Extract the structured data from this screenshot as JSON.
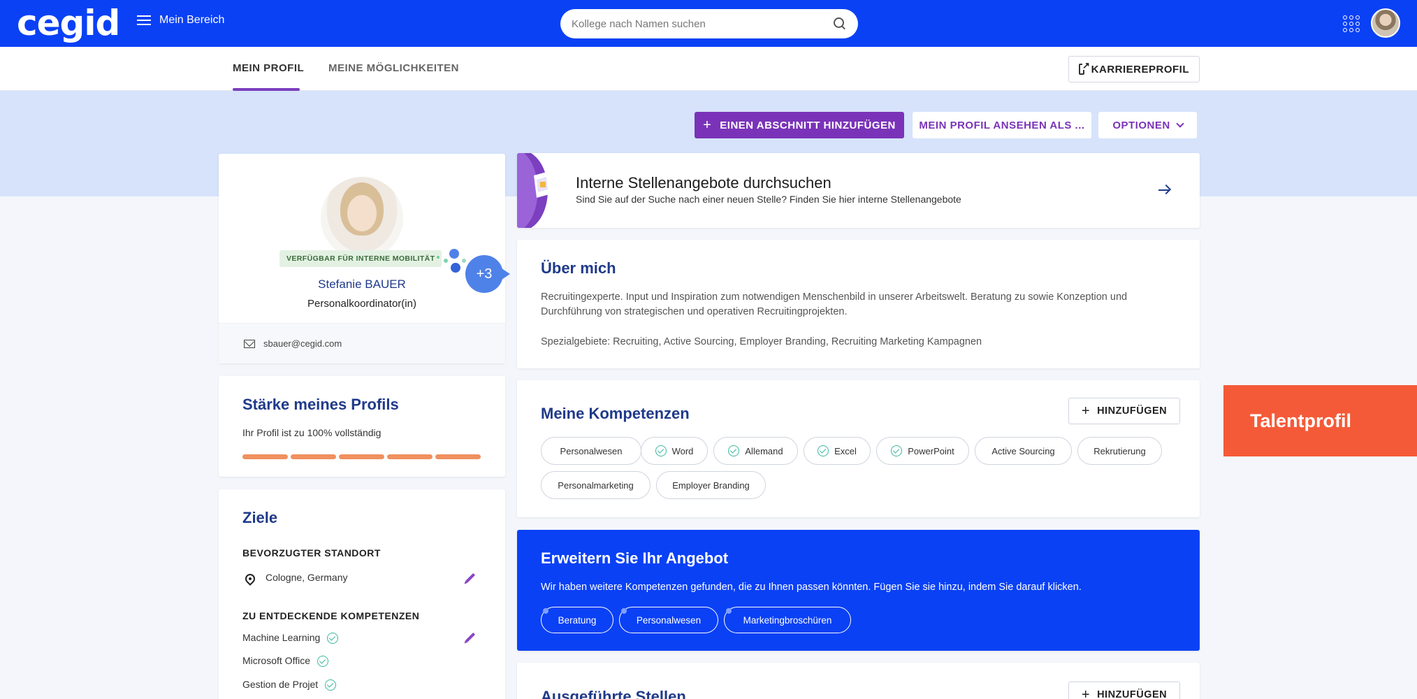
{
  "header": {
    "logo": "cegid",
    "menu_label": "Mein Bereich",
    "search_placeholder": "Kollege nach Namen suchen"
  },
  "tabs": [
    {
      "label": "MEIN PROFIL",
      "active": true
    },
    {
      "label": "MEINE MÖGLICHKEITEN",
      "active": false
    }
  ],
  "career_button": "KARRIEREPROFIL",
  "actions": {
    "add_section": "EINEN ABSCHNITT HINZUFÜGEN",
    "view_as": "MEIN PROFIL ANSEHEN ALS ...",
    "options": "OPTIONEN"
  },
  "profile": {
    "mobility_badge": "VERFÜGBAR FÜR INTERNE MOBILITÄT",
    "more_count": "+3",
    "name": "Stefanie BAUER",
    "role": "Personalkoordinator(in)",
    "email": "sbauer@cegid.com"
  },
  "strength": {
    "title": "Stärke meines Profils",
    "text": "Ihr Profil ist zu 100% vollständig",
    "percent": 100,
    "color": "#f0905e"
  },
  "goals": {
    "title": "Ziele",
    "location_label": "BEVORZUGTER STANDORT",
    "location": "Cologne, Germany",
    "skills_label": "ZU ENTDECKENDE KOMPETENZEN",
    "skills": [
      "Machine Learning",
      "Microsoft Office",
      "Gestion de Projet"
    ]
  },
  "jobs": {
    "title": "Interne Stellenangebote durchsuchen",
    "subtitle": "Sind Sie auf der Suche nach einer neuen Stelle? Finden Sie hier interne Stellenangebote"
  },
  "about": {
    "title": "Über mich",
    "text1": "Recruitingexperte. Input und Inspiration zum notwendigen Menschenbild in unserer Arbeitswelt. Beratung zu sowie Konzeption und Durchführung von strategischen und operativen Recruitingprojekten.",
    "text2": "Spezialgebiete: Recruiting, Active Sourcing, Employer Branding, Recruiting Marketing Kampagnen"
  },
  "skills": {
    "title": "Meine Kompetenzen",
    "add_label": "HINZUFÜGEN",
    "items": [
      {
        "label": "Personalwesen",
        "verified": false
      },
      {
        "label": "Word",
        "verified": true
      },
      {
        "label": "Allemand",
        "verified": true
      },
      {
        "label": "Excel",
        "verified": true
      },
      {
        "label": "PowerPoint",
        "verified": true
      },
      {
        "label": "Active Sourcing",
        "verified": false
      },
      {
        "label": "Rekrutierung",
        "verified": false
      },
      {
        "label": "Personalmarketing",
        "verified": false
      },
      {
        "label": "Employer Branding",
        "verified": false
      }
    ]
  },
  "extend": {
    "title": "Erweitern Sie Ihr Angebot",
    "text": "Wir haben weitere Kompetenzen gefunden, die zu Ihnen passen könnten. Fügen Sie sie hinzu, indem Sie darauf klicken.",
    "suggestions": [
      "Beratung",
      "Personalwesen",
      "Marketingbroschüren"
    ]
  },
  "positions": {
    "title": "Ausgeführte Stellen",
    "add_label": "HINZUFÜGEN"
  },
  "talent_tab": "Talentprofil",
  "colors": {
    "brand_blue": "#0a41f5",
    "accent_purple": "#7a33b8",
    "talent_orange": "#f55a38"
  }
}
